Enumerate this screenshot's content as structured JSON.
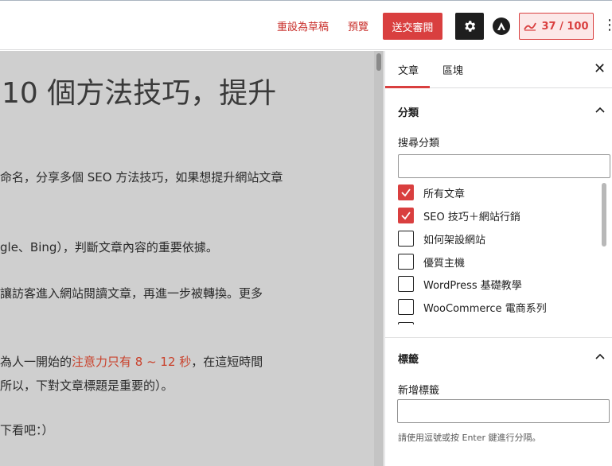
{
  "toolbar": {
    "save_draft": "重設為草稿",
    "preview": "預覽",
    "submit": "送交審閱",
    "score": "37 / 100",
    "settings_icon": "gear-icon",
    "astra_icon": "astra-logo-icon",
    "more_icon": "kebab-icon",
    "accent_color": "#d93f3f"
  },
  "editor": {
    "title": "10 個方法技巧，提升",
    "paragraphs": [
      "命名，分享多個 SEO 方法技巧，如果想提升網站文章",
      "gle、Bing），判斷文章內容的重要依據。",
      "讓訪客進入網站閱讀文章，再進一步被轉換。更多",
      "下看吧：）"
    ],
    "para4_before": "為人一開始的",
    "para4_highlight": "注意力只有 8 ~ 12 秒",
    "para4_after": "，在這短時間",
    "para5": "所以，下對文章標題是重要的）。"
  },
  "sidebar": {
    "tab_post": "文章",
    "tab_block": "區塊",
    "categories": {
      "title": "分類",
      "search_label": "搜尋分類",
      "items": [
        {
          "label": "所有文章",
          "checked": true
        },
        {
          "label": "SEO 技巧＋網站行銷",
          "checked": true
        },
        {
          "label": "如何架設網站",
          "checked": false
        },
        {
          "label": "優質主機",
          "checked": false
        },
        {
          "label": "WordPress 基礎教學",
          "checked": false
        },
        {
          "label": "WooCommerce 電商系列",
          "checked": false
        }
      ]
    },
    "tags": {
      "title": "標籤",
      "add_label": "新增標籤",
      "hint": "請使用逗號或按 Enter 鍵進行分隔。"
    }
  }
}
